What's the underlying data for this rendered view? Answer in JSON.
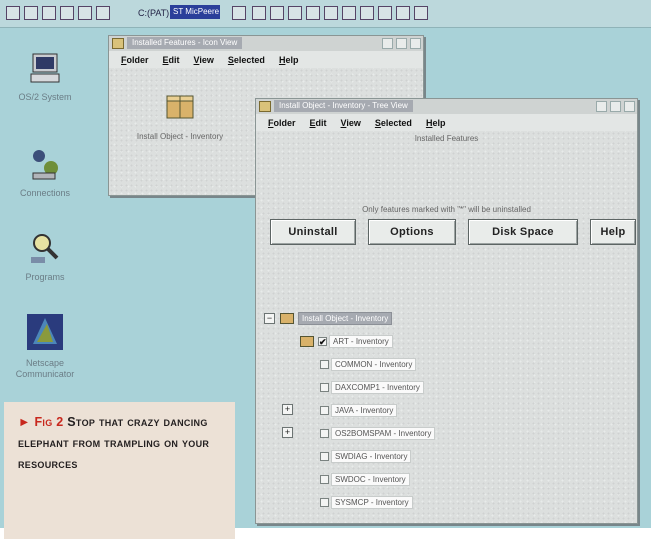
{
  "launchpad": {
    "active_task": "ST MicPeere",
    "path": "C:(PAT)"
  },
  "desktop": {
    "icons": [
      {
        "label": "OS/2 System",
        "icon": "computer-icon"
      },
      {
        "label": "Connections",
        "icon": "network-icon"
      },
      {
        "label": "Programs",
        "icon": "magnifier-icon"
      },
      {
        "label": "Netscape Communicator",
        "icon": "netscape-icon"
      }
    ]
  },
  "window_small": {
    "title": "Installed Features - Icon View",
    "menu": [
      "Folder",
      "Edit",
      "View",
      "Selected",
      "Help"
    ],
    "icon_label": "Install Object - Inventory",
    "icon": "package-icon"
  },
  "window_main": {
    "title": "Install Object - Inventory - Tree View",
    "menu": [
      "Folder",
      "Edit",
      "View",
      "Selected",
      "Help"
    ],
    "header": "Installed Features",
    "note": "Only features marked with \"*\" will be uninstalled",
    "buttons": {
      "uninstall": "Uninstall",
      "options": "Options",
      "disk_space": "Disk Space",
      "help": "Help"
    },
    "tree_root": "Install Object - Inventory",
    "tree_items": [
      {
        "label": "ART - Inventory",
        "checked": true,
        "mark": "✔",
        "expander": ""
      },
      {
        "label": "COMMON - Inventory",
        "checked": false,
        "mark": "",
        "expander": ""
      },
      {
        "label": "DAXCOMP1 - Inventory",
        "checked": false,
        "mark": "",
        "expander": ""
      },
      {
        "label": "JAVA - Inventory",
        "checked": false,
        "mark": "",
        "expander": "+"
      },
      {
        "label": "OS2BOMSPAM - Inventory",
        "checked": false,
        "mark": "",
        "expander": "+"
      },
      {
        "label": "SWDIAG - Inventory",
        "checked": false,
        "mark": "",
        "expander": ""
      },
      {
        "label": "SWDOC - Inventory",
        "checked": false,
        "mark": "",
        "expander": ""
      },
      {
        "label": "SYSMCP - Inventory",
        "checked": false,
        "mark": "",
        "expander": ""
      }
    ]
  },
  "caption": {
    "arrow": "►",
    "fig": "Fig 2",
    "text": "Stop that crazy dancing elephant from trampling on your resources"
  },
  "colors": {
    "desktop": "#a9d2d8",
    "caption_bg": "#ece1d6",
    "caption_accent": "#c8281e"
  }
}
